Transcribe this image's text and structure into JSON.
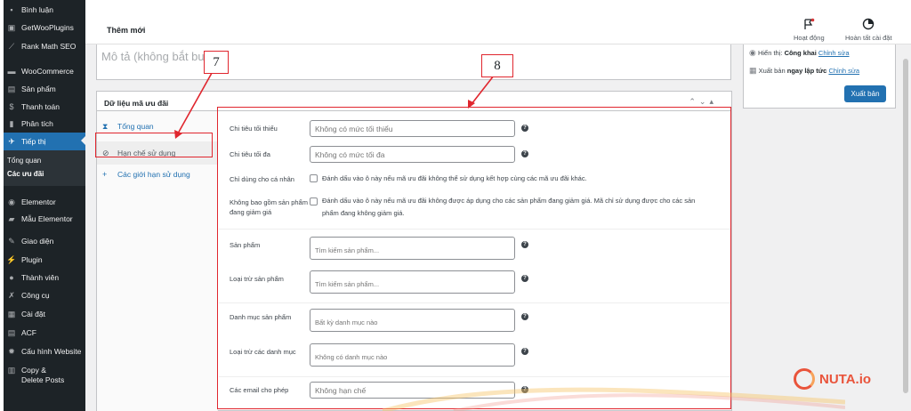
{
  "sidebar": {
    "items": [
      {
        "label": "Bình luận",
        "icon": "comment-icon",
        "glyph": "▪"
      },
      {
        "label": "GetWooPlugins",
        "icon": "plugin-grid-icon",
        "glyph": "▣"
      },
      {
        "label": "Rank Math SEO",
        "icon": "chart-line-icon",
        "glyph": "⟋"
      },
      {
        "label": "WooCommerce",
        "icon": "woocommerce-icon",
        "glyph": "▬"
      },
      {
        "label": "Sản phẩm",
        "icon": "archive-icon",
        "glyph": "▤"
      },
      {
        "label": "Thanh toán",
        "icon": "dollar-icon",
        "glyph": "$"
      },
      {
        "label": "Phân tích",
        "icon": "bar-chart-icon",
        "glyph": "▮"
      },
      {
        "label": "Tiếp thị",
        "icon": "megaphone-icon",
        "glyph": "✈"
      },
      {
        "label": "Elementor",
        "icon": "elementor-icon",
        "glyph": "◉"
      },
      {
        "label": "Mẫu Elementor",
        "icon": "folder-icon",
        "glyph": "▰"
      },
      {
        "label": "Giao diện",
        "icon": "brush-icon",
        "glyph": "✎"
      },
      {
        "label": "Plugin",
        "icon": "plug-icon",
        "glyph": "⚡"
      },
      {
        "label": "Thành viên",
        "icon": "user-icon",
        "glyph": "●"
      },
      {
        "label": "Công cụ",
        "icon": "wrench-icon",
        "glyph": "✗"
      },
      {
        "label": "Cài đặt",
        "icon": "settings-icon",
        "glyph": "▦"
      },
      {
        "label": "ACF",
        "icon": "acf-icon",
        "glyph": "▤"
      },
      {
        "label": "Cấu hình Website",
        "icon": "gear-icon",
        "glyph": "✹"
      },
      {
        "label": "Copy &",
        "icon": "copy-icon",
        "glyph": "▥"
      }
    ],
    "copy_line2": "Delete Posts",
    "submenu": [
      "Tổng quan",
      "Các ưu đãi"
    ]
  },
  "topbar": {
    "title": "Thêm mới",
    "activity": "Hoạt động",
    "finish_setup": "Hoàn tất cài đặt"
  },
  "excerpt": {
    "placeholder": "Mô tả (không bắt buộc)"
  },
  "panel": {
    "title": "Dữ liệu mã ưu đãi",
    "tabs": [
      {
        "label": "Tổng quan",
        "icon": "ticket-icon"
      },
      {
        "label": "Hạn chế sử dụng",
        "icon": "block-icon"
      },
      {
        "label": "Các giới hạn sử dụng",
        "icon": "plus-icon"
      }
    ],
    "fields": {
      "min_spend": {
        "label": "Chi tiêu tối thiểu",
        "placeholder": "Không có mức tối thiểu"
      },
      "max_spend": {
        "label": "Chi tiêu tối đa",
        "placeholder": "Không có mức tối đa"
      },
      "individual": {
        "label": "Chỉ dùng cho cá nhân",
        "text": "Đánh dấu vào ô này nếu mã ưu đãi không thể sử dụng kết hợp cùng các mã ưu đãi khác."
      },
      "exclude_sale": {
        "label_line1": "Không bao gồm sản phẩm",
        "label_line2": "đang giảm giá",
        "text_line1": "Đánh dấu vào ô này nếu mã ưu đãi không được áp dụng cho các sản phẩm đang giảm giá. Mã chỉ sử dụng được cho các sản",
        "text_line2": "phẩm đang không giảm giá."
      },
      "products": {
        "label": "Sản phẩm",
        "placeholder": "Tìm kiếm sản phẩm..."
      },
      "exclude_products": {
        "label": "Loại trừ sản phẩm",
        "placeholder": "Tìm kiếm sản phẩm..."
      },
      "categories": {
        "label": "Danh mục sản phẩm",
        "placeholder": "Bất kỳ danh mục nào"
      },
      "exclude_categories": {
        "label": "Loại trừ các danh mục",
        "placeholder": "Không có danh mục nào"
      },
      "allowed_emails": {
        "label": "Các email cho phép",
        "placeholder": "Không hạn chế"
      }
    }
  },
  "meta": {
    "visibility_label": "Hiển thị:",
    "visibility_value": "Công khai",
    "visibility_edit": "Chỉnh sửa",
    "publish_label": "Xuất bản",
    "publish_value": "ngay lập tức",
    "publish_edit": "Chỉnh sửa",
    "publish_button": "Xuất bản"
  },
  "annotations": {
    "callout_7": "7",
    "callout_8": "8"
  },
  "watermark": {
    "brand": "NUTA.io"
  },
  "colors": {
    "accent": "#2271b1",
    "annotation_red": "#e0262e",
    "sidebar_bg": "#1d2327"
  }
}
